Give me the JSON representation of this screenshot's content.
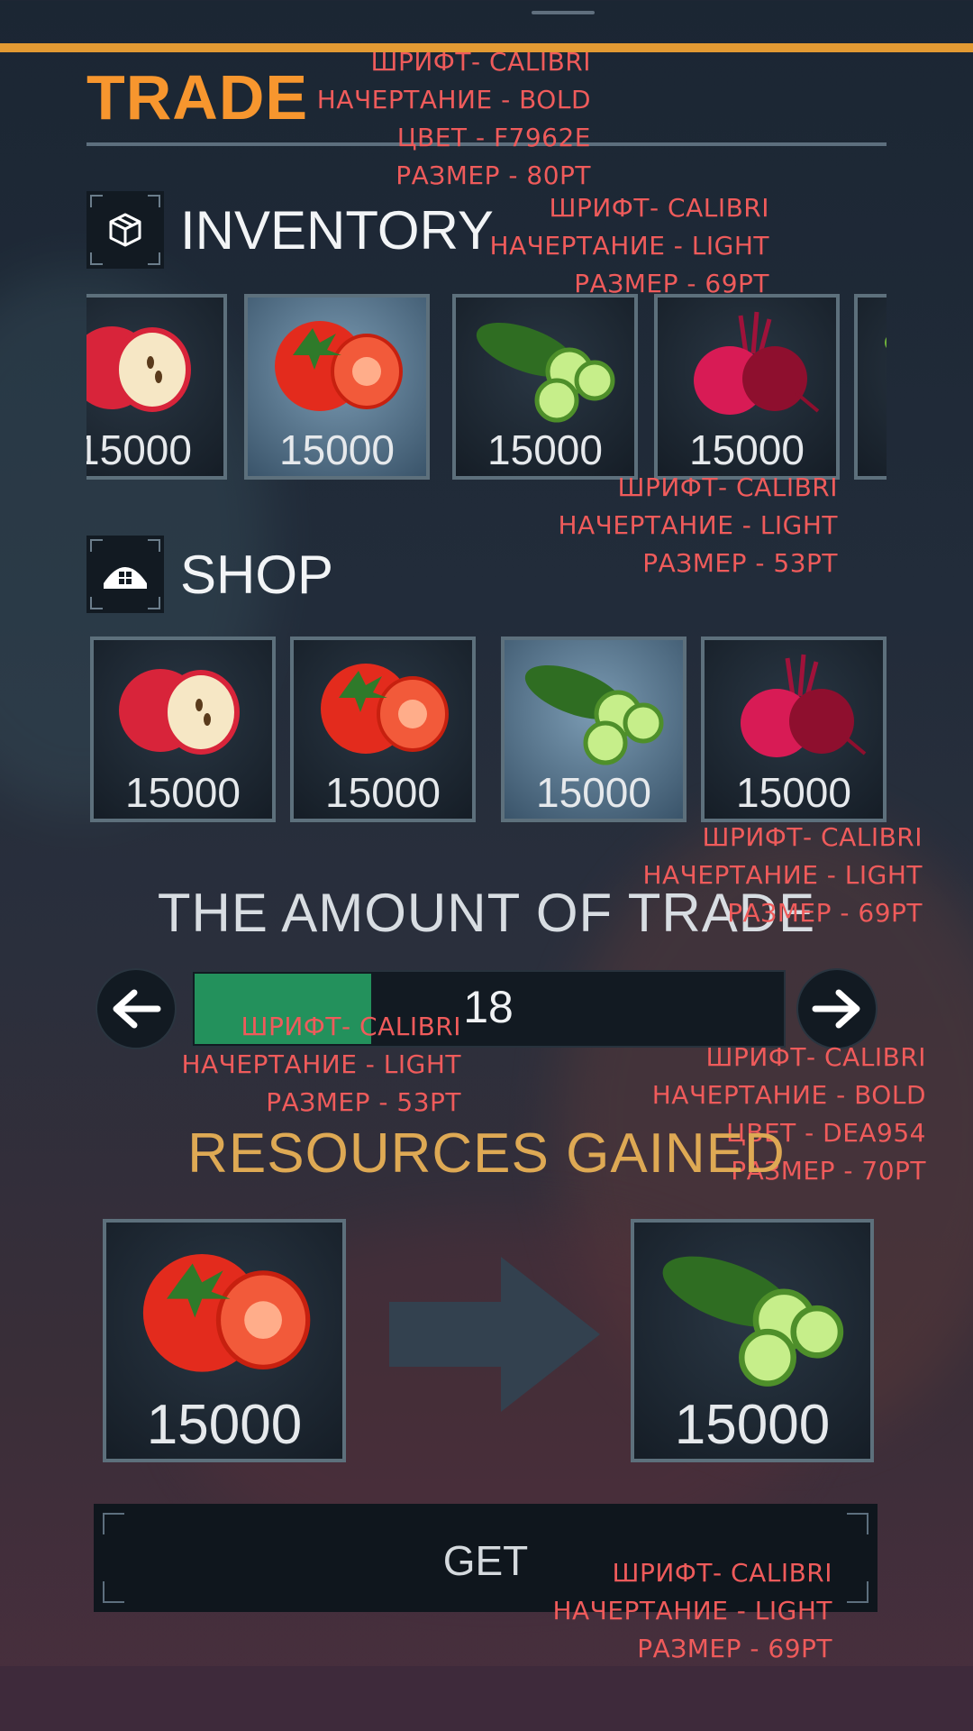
{
  "header": {
    "title": "TRADE"
  },
  "notes": {
    "title": [
      "ШРИФТ- CALIBRI",
      "НАЧЕРТАНИЕ - BOLD",
      "ЦВЕТ - F7962E",
      "РАЗМЕР - 80PT"
    ],
    "inventory": [
      "ШРИФТ- CALIBRI",
      "НАЧЕРТАНИЕ - LIGHT",
      "РАЗМЕР - 69PT"
    ],
    "card_qty": [
      "ШРИФТ- CALIBRI",
      "НАЧЕРТАНИЕ - LIGHT",
      "РАЗМЕР - 53PT"
    ],
    "amount_title": [
      "ШРИФТ- CALIBRI",
      "НАЧЕРТАНИЕ - LIGHT",
      "РАЗМЕР - 69PT"
    ],
    "slider": [
      "ШРИФТ- CALIBRI",
      "НАЧЕРТАНИЕ - LIGHT",
      "РАЗМЕР - 53PT"
    ],
    "resources": [
      "ШРИФТ- CALIBRI",
      "НАЧЕРТАНИЕ - BOLD",
      "ЦВЕТ - DEA954",
      "РАЗМЕР - 70PT"
    ],
    "get": [
      "ШРИФТ- CALIBRI",
      "НАЧЕРТАНИЕ - LIGHT",
      "РАЗМЕР - 69PT"
    ]
  },
  "inventory": {
    "label": "INVENTORY",
    "icon": "cube-icon",
    "items": [
      {
        "fruit": "apple",
        "qty": "15000",
        "selected": false
      },
      {
        "fruit": "tomato",
        "qty": "15000",
        "selected": true
      },
      {
        "fruit": "cucumber",
        "qty": "15000",
        "selected": false
      },
      {
        "fruit": "beet",
        "qty": "15000",
        "selected": false
      },
      {
        "fruit": "cucumber",
        "qty": "",
        "selected": false
      }
    ]
  },
  "shop": {
    "label": "SHOP",
    "icon": "shop-icon",
    "items": [
      {
        "fruit": "apple",
        "qty": "15000",
        "selected": false
      },
      {
        "fruit": "tomato",
        "qty": "15000",
        "selected": false
      },
      {
        "fruit": "cucumber",
        "qty": "15000",
        "selected": true
      },
      {
        "fruit": "beet",
        "qty": "15000",
        "selected": false
      }
    ]
  },
  "amount": {
    "title": "THE AMOUNT OF TRADE",
    "value": "18",
    "fill_fraction": 0.3,
    "fill_color": "#23915c"
  },
  "resources": {
    "title": "RESOURCES GAINED",
    "give": {
      "fruit": "tomato",
      "qty": "15000"
    },
    "get": {
      "fruit": "cucumber",
      "qty": "15000"
    }
  },
  "get_button": {
    "label": "GET"
  },
  "colors": {
    "accent": "#F7962E",
    "resources": "#DEA954",
    "note": "#ef5b5b"
  }
}
